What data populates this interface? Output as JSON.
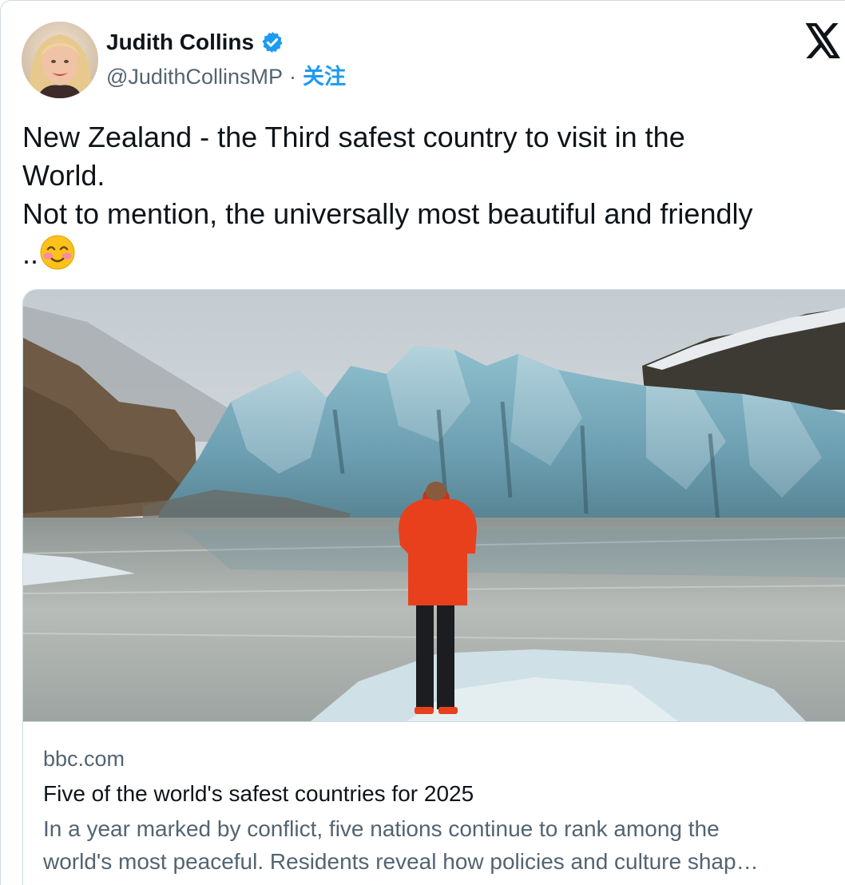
{
  "author": {
    "name": "Judith Collins",
    "handle": "@JudithCollinsMP",
    "separator": "·",
    "follow_label": "关注",
    "verified_icon": "verified-badge-icon",
    "avatar_icon": "profile-avatar"
  },
  "brand": {
    "logo_icon": "x-logo-icon"
  },
  "tweet": {
    "line1": "New Zealand  - the Third safest country to visit in the",
    "line2": "World.",
    "line3": "Not to mention, the universally most beautiful and friendly",
    "line4": "..",
    "emoji_icon": "smiling-face-with-blush-emoji"
  },
  "card": {
    "image_icon": "glacier-lagoon-photo",
    "domain": "bbc.com",
    "title": "Five of the world's safest countries for 2025",
    "desc_line1": "In a year marked by conflict, five nations continue to rank among the",
    "desc_line2": "world's most peaceful. Residents reveal how policies and culture shap…"
  },
  "colors": {
    "link_blue": "#1d9bf0",
    "secondary_text": "#536471",
    "border": "#cfd9de",
    "jacket_red": "#e8401c"
  }
}
